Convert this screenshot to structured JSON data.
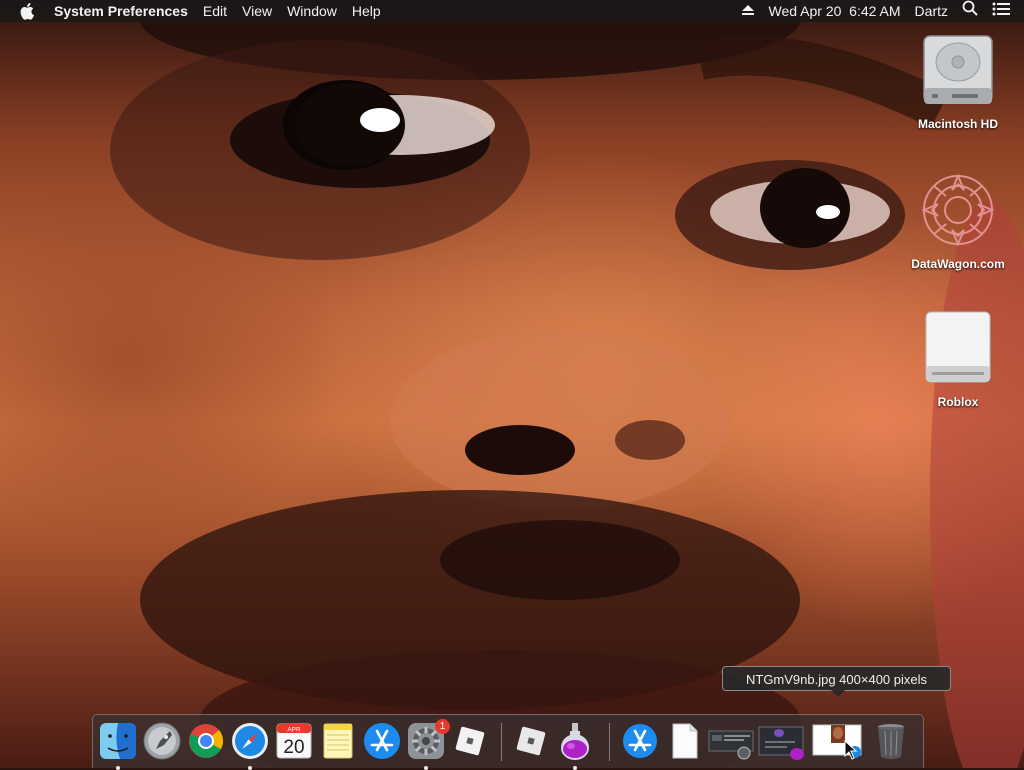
{
  "menubar": {
    "apple": "apple-icon",
    "app_name": "System Preferences",
    "menus": [
      "Edit",
      "View",
      "Window",
      "Help"
    ],
    "datetime": "Wed Apr 20  6:42 AM",
    "user": "Dartz",
    "status_icons": [
      "eject-icon",
      "spotlight-icon",
      "notification-center-icon"
    ]
  },
  "desktop": {
    "icons": [
      {
        "label": "Macintosh HD",
        "icon": "hard-drive-icon"
      },
      {
        "label": "DataWagon.com",
        "icon": "datawagon-logo-icon"
      },
      {
        "label": "Roblox",
        "icon": "external-drive-icon"
      }
    ]
  },
  "tooltip": {
    "text": "NTGmV9nb.jpg 400×400 pixels"
  },
  "dock": {
    "items": [
      {
        "name": "Finder",
        "running": true
      },
      {
        "name": "Launchpad",
        "running": false
      },
      {
        "name": "Google Chrome",
        "running": false
      },
      {
        "name": "Safari",
        "running": true
      },
      {
        "name": "Calendar",
        "running": false,
        "month": "APR",
        "day": "20"
      },
      {
        "name": "Notes",
        "running": false
      },
      {
        "name": "App Store",
        "running": false
      },
      {
        "name": "System Preferences",
        "running": true,
        "badge": "1"
      },
      {
        "name": "Roblox",
        "running": false
      },
      {
        "name": "Roblox Studio",
        "running": false
      },
      {
        "name": "Installer",
        "running": true
      },
      {
        "name": "App Store Downloads",
        "running": false
      },
      {
        "name": "Document",
        "running": false
      },
      {
        "name": "Screenshot",
        "running": false
      },
      {
        "name": "Installer Stack",
        "running": false
      },
      {
        "name": "NTGmV9nb.jpg",
        "running": false
      },
      {
        "name": "Trash",
        "running": false
      }
    ]
  },
  "colors": {
    "menubar_bg": "#1c1818",
    "badge": "#e8392b",
    "safari_blue": "#1e88e5"
  }
}
